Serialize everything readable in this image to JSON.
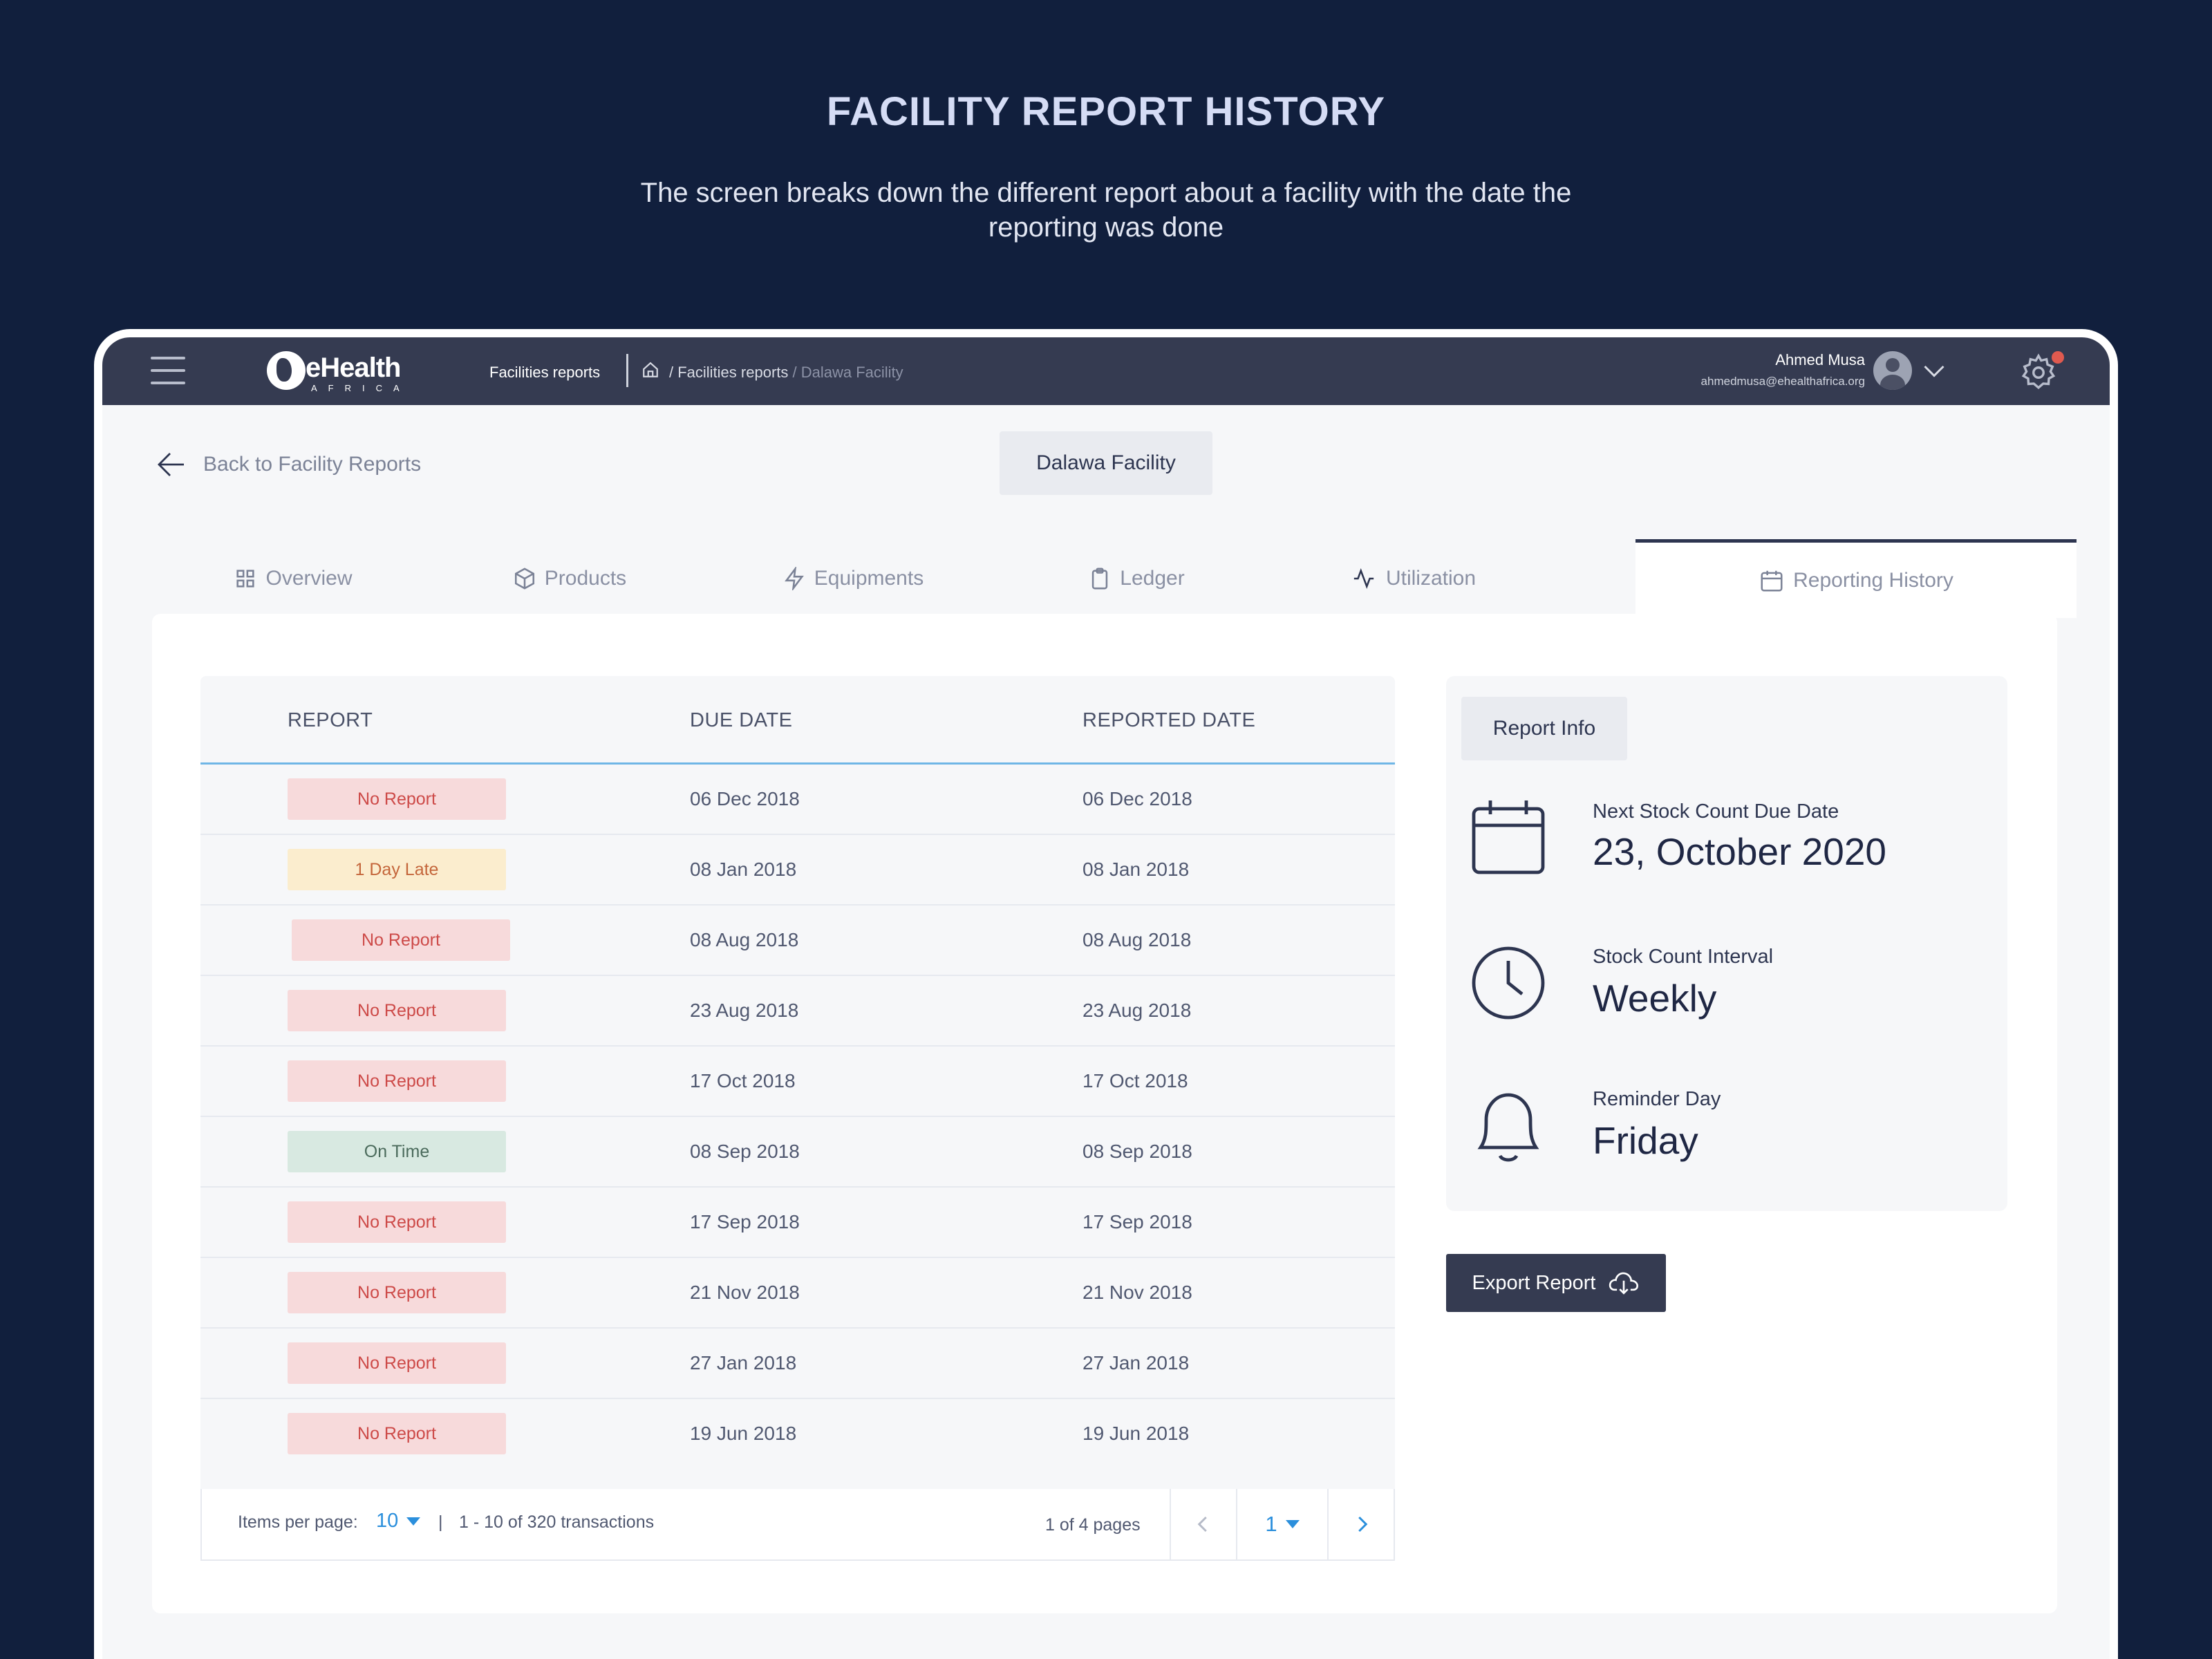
{
  "hero": {
    "title": "FACILITY REPORT HISTORY",
    "subtitle": "The screen breaks down the different  report about a facility with the date the reporting was done"
  },
  "topbar": {
    "logo_name": "eHealth",
    "logo_sub": "AFRICA",
    "breadcrumb_main": "Facilities reports",
    "breadcrumb_path": "/ Facilities reports",
    "breadcrumb_current": "/ Dalawa Facility",
    "user_name": "Ahmed Musa",
    "user_email": "ahmedmusa@ehealthafrica.org",
    "icons": [
      "menu-icon",
      "home-icon",
      "avatar",
      "chevron-down-icon",
      "gear-icon"
    ]
  },
  "page": {
    "back_label": "Back to Facility Reports",
    "facility_name": "Dalawa Facility"
  },
  "tabs": [
    {
      "label": "Overview",
      "icon": "grid-icon"
    },
    {
      "label": "Products",
      "icon": "box-icon"
    },
    {
      "label": "Equipments",
      "icon": "lightning-icon"
    },
    {
      "label": "Ledger",
      "icon": "clipboard-icon"
    },
    {
      "label": "Utilization",
      "icon": "pulse-icon"
    },
    {
      "label": "Reporting History",
      "icon": "calendar-icon",
      "active": true
    }
  ],
  "table": {
    "columns": [
      "REPORT",
      "DUE DATE",
      "REPORTED DATE"
    ],
    "rows": [
      {
        "status": "No Report",
        "due": "06 Dec 2018",
        "reported": "06 Dec 2018"
      },
      {
        "status": "1 Day Late",
        "due": "08 Jan 2018",
        "reported": "08 Jan 2018"
      },
      {
        "status": "No Report",
        "due": "08 Aug 2018",
        "reported": "08 Aug 2018"
      },
      {
        "status": "No Report",
        "due": "23 Aug 2018",
        "reported": "23 Aug 2018"
      },
      {
        "status": "No Report",
        "due": "17 Oct 2018",
        "reported": "17 Oct 2018"
      },
      {
        "status": "On Time",
        "due": "08 Sep 2018",
        "reported": "08 Sep 2018"
      },
      {
        "status": "No Report",
        "due": "17 Sep 2018",
        "reported": "17 Sep 2018"
      },
      {
        "status": "No Report",
        "due": "21 Nov 2018",
        "reported": "21 Nov 2018"
      },
      {
        "status": "No Report",
        "due": "27 Jan 2018",
        "reported": "27 Jan 2018"
      },
      {
        "status": "No Report",
        "due": "19 Jun 2018",
        "reported": "19 Jun 2018"
      }
    ],
    "status_colors": {
      "no_report": {
        "bg": "#f7dadb",
        "fg": "#cd4a48"
      },
      "late": {
        "bg": "#fbedce",
        "fg": "#c4663b"
      },
      "on_time": {
        "bg": "#d8e9e1",
        "fg": "#4b6b5c"
      }
    }
  },
  "pagination": {
    "items_label": "Items per page:",
    "items_value": "10",
    "separator": "|",
    "range_text": "1 - 10 of 320 transactions",
    "pages_text": "1 of 4 pages",
    "current_page": "1"
  },
  "report_info": {
    "title": "Report Info",
    "items": [
      {
        "label": "Next Stock Count Due Date",
        "value": "23, October 2020",
        "icon": "calendar-icon"
      },
      {
        "label": "Stock Count Interval",
        "value": "Weekly",
        "icon": "clock-icon"
      },
      {
        "label": "Reminder Day",
        "value": "Friday",
        "icon": "bell-icon"
      }
    ]
  },
  "export": {
    "label": "Export Report",
    "icon": "cloud-download-icon"
  },
  "colors": {
    "background": "#111f3d",
    "topbar": "#353b51",
    "accent": "#2b8fdc",
    "table_header_rule": "#6fb6e6"
  }
}
